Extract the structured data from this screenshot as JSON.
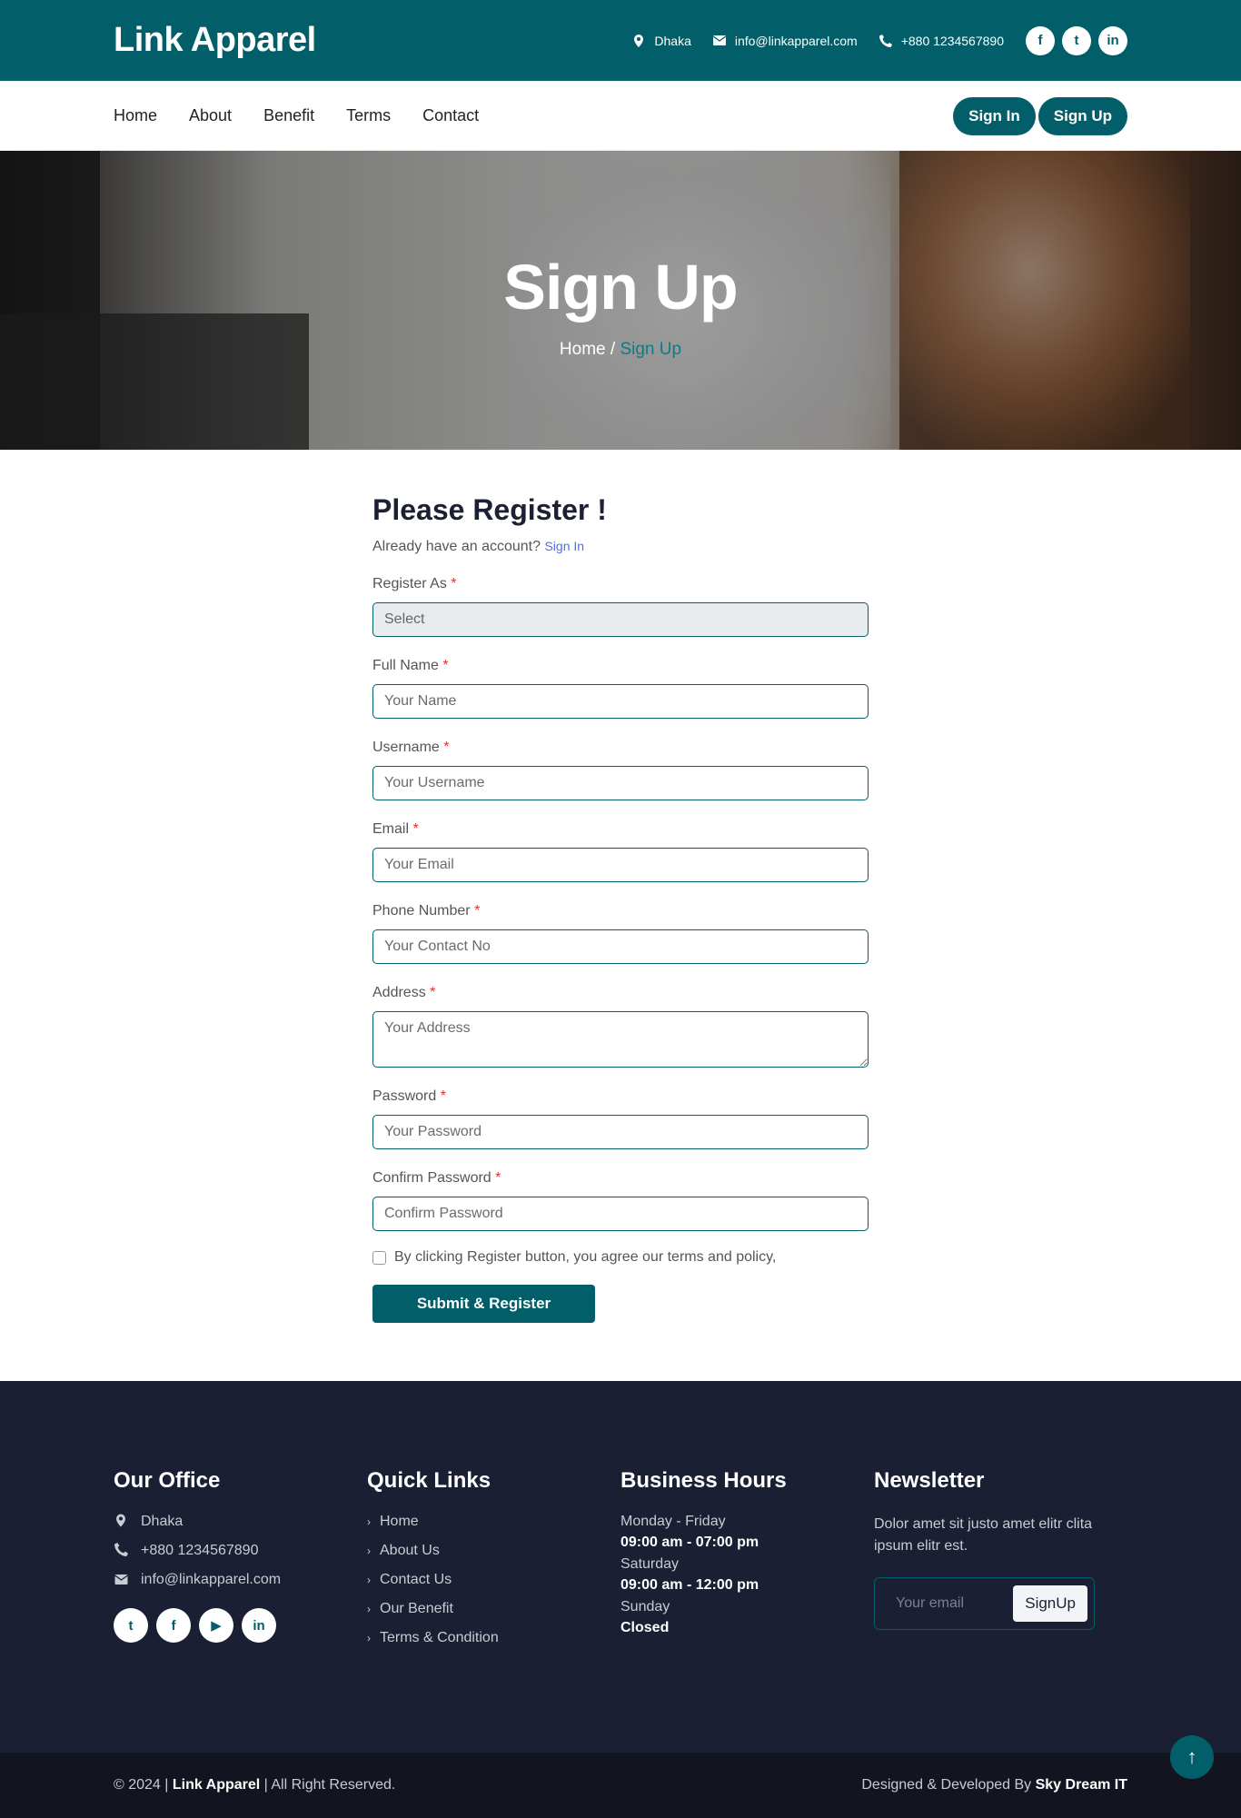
{
  "topbar": {
    "brand": "Link Apparel",
    "location": "Dhaka",
    "email": "info@linkapparel.com",
    "phone": "+880 1234567890",
    "social": [
      "f",
      "t",
      "in"
    ]
  },
  "nav": {
    "links": [
      "Home",
      "About",
      "Benefit",
      "Terms",
      "Contact"
    ],
    "signin": "Sign In",
    "signup": "Sign Up"
  },
  "hero": {
    "title": "Sign Up",
    "crumb_home": "Home",
    "crumb_sep": "/",
    "crumb_current": "Sign Up"
  },
  "form": {
    "title": "Please Register !",
    "already": "Already have an account?",
    "signin_link": "Sign In",
    "fields": [
      {
        "label": "Register As",
        "value": "Select"
      },
      {
        "label": "Full Name",
        "placeholder": "Your Name"
      },
      {
        "label": "Username",
        "placeholder": "Your Username"
      },
      {
        "label": "Email",
        "placeholder": "Your Email"
      },
      {
        "label": "Phone Number",
        "placeholder": "Your Contact No"
      },
      {
        "label": "Address",
        "placeholder": "Your Address"
      },
      {
        "label": "Password",
        "placeholder": "Your Password"
      },
      {
        "label": "Confirm Password",
        "placeholder": "Confirm Password"
      }
    ],
    "required_mark": "*",
    "agree": "By clicking Register button, you agree our terms and policy,",
    "submit": "Submit & Register"
  },
  "footer": {
    "office": {
      "title": "Our Office",
      "location": "Dhaka",
      "phone": "+880 1234567890",
      "email": "info@linkapparel.com",
      "social": [
        "t",
        "f",
        "▶",
        "in"
      ]
    },
    "links": {
      "title": "Quick Links",
      "items": [
        "Home",
        "About Us",
        "Contact Us",
        "Our Benefit",
        "Terms & Condition"
      ]
    },
    "hours": {
      "title": "Business Hours",
      "rows": [
        {
          "day": "Monday - Friday",
          "time": "09:00 am - 07:00 pm"
        },
        {
          "day": "Saturday",
          "time": "09:00 am - 12:00 pm"
        },
        {
          "day": "Sunday",
          "time": "Closed"
        }
      ]
    },
    "newsletter": {
      "title": "Newsletter",
      "text": "Dolor amet sit justo amet elitr clita ipsum elitr est.",
      "placeholder": "Your email",
      "button": "SignUp"
    }
  },
  "bottom": {
    "copy_prefix": "© 2024 |",
    "copy_brand": "Link Apparel",
    "copy_suffix": "| All Right Reserved.",
    "credit_prefix": "Designed & Developed By",
    "credit_name": "Sky Dream IT"
  },
  "colors": {
    "primary": "#025e68",
    "footer": "#1b1f33",
    "bottom": "#12141f"
  }
}
